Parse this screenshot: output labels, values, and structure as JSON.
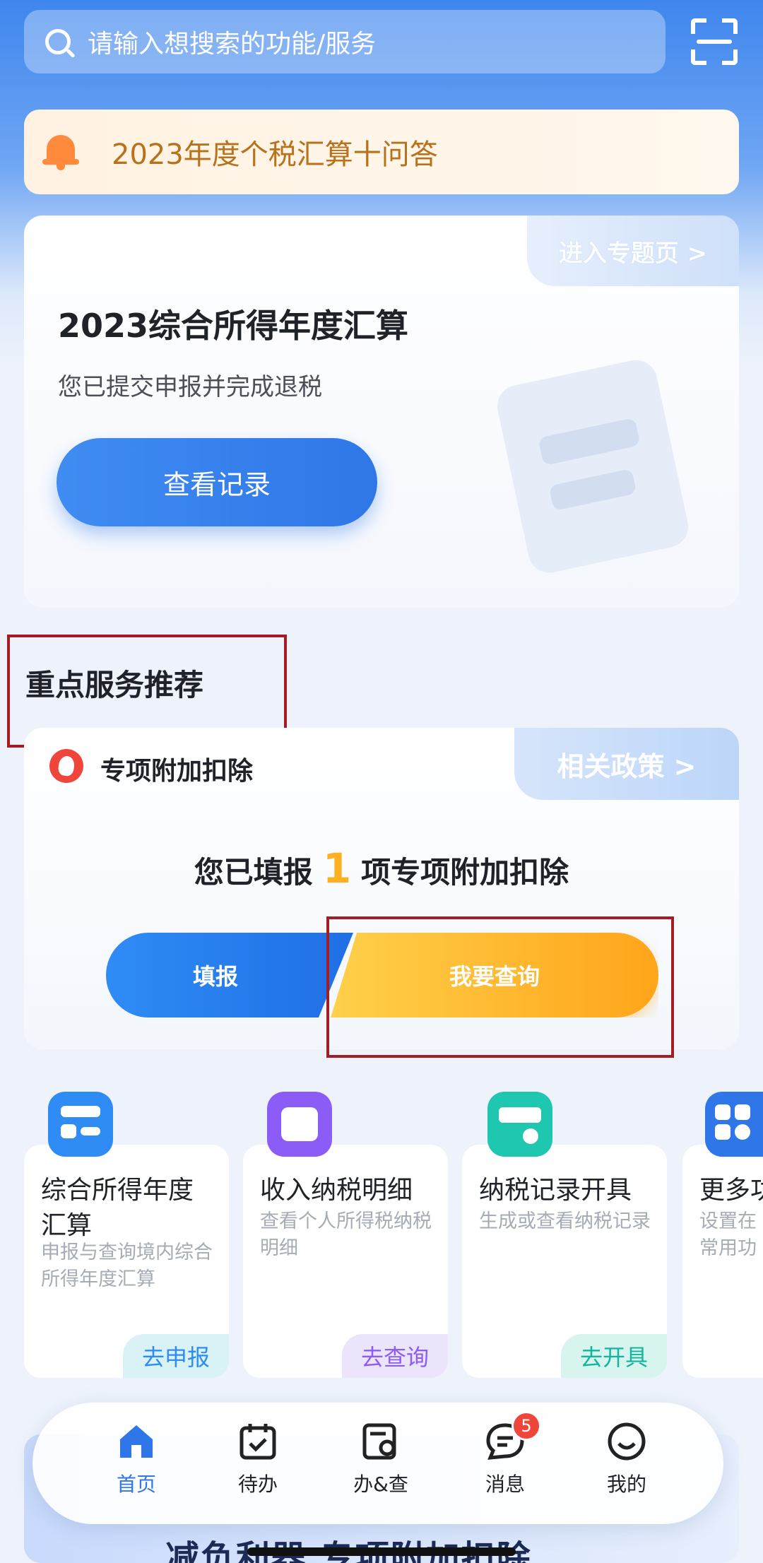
{
  "search": {
    "placeholder": "请输入想搜索的功能/服务"
  },
  "notice": {
    "text": "2023年度个税汇算十问答"
  },
  "annual_card": {
    "topic_link": "进入专题页 >",
    "title": "2023综合所得年度汇算",
    "subtitle": "您已提交申报并完成退税",
    "button": "查看记录"
  },
  "section": {
    "title": "重点服务推荐"
  },
  "deduction_card": {
    "header": "专项附加扣除",
    "policy_link": "相关政策 >",
    "status_prefix": "您已填报",
    "count": "1",
    "status_suffix": "项专项附加扣除",
    "fill_button": "填报",
    "query_button": "我要查询"
  },
  "services": [
    {
      "title": "综合所得年度汇算",
      "desc": "申报与查询境内综合所得年度汇算",
      "action": "去申报",
      "color": "#2f8cf5"
    },
    {
      "title": "收入纳税明细",
      "desc": "查看个人所得税纳税明细",
      "action": "去查询",
      "color": "#8b5cf6"
    },
    {
      "title": "纳税记录开具",
      "desc": "生成或查看纳税记录",
      "action": "去开具",
      "color": "#1fc7b0"
    },
    {
      "title": "更多功",
      "desc": "设置在常用功",
      "action": "",
      "color": "#2f77e8"
    }
  ],
  "banner": {
    "text": "减负利器 专项附加扣除"
  },
  "nav": [
    {
      "label": "首页",
      "icon": "home-icon",
      "active": true
    },
    {
      "label": "待办",
      "icon": "calendar-check-icon"
    },
    {
      "label": "办&查",
      "icon": "doc-search-icon"
    },
    {
      "label": "消息",
      "icon": "message-icon",
      "badge": "5"
    },
    {
      "label": "我的",
      "icon": "smile-icon"
    }
  ]
}
